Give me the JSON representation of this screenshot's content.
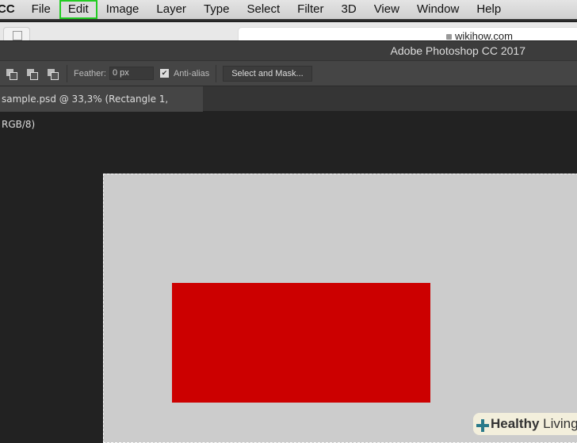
{
  "colors": {
    "highlight": "#22cc22",
    "rectangle": "#cc0000",
    "canvas": "#cccccc"
  },
  "menubar": {
    "app": "CC",
    "items": [
      "File",
      "Edit",
      "Image",
      "Layer",
      "Type",
      "Select",
      "Filter",
      "3D",
      "View",
      "Window",
      "Help"
    ],
    "highlighted": "Edit"
  },
  "browser": {
    "url": "wikihow.com"
  },
  "title": "Adobe Photoshop CC 2017",
  "options": {
    "feather_label": "Feather:",
    "feather_value": "0 px",
    "antialias_label": "Anti-alias",
    "antialias_checked": true,
    "select_mask_label": "Select and Mask..."
  },
  "document_tab": "sample.psd @ 33,3% (Rectangle 1, RGB/8)",
  "watermark": {
    "bold": "Healthy",
    "rest": " Living"
  }
}
